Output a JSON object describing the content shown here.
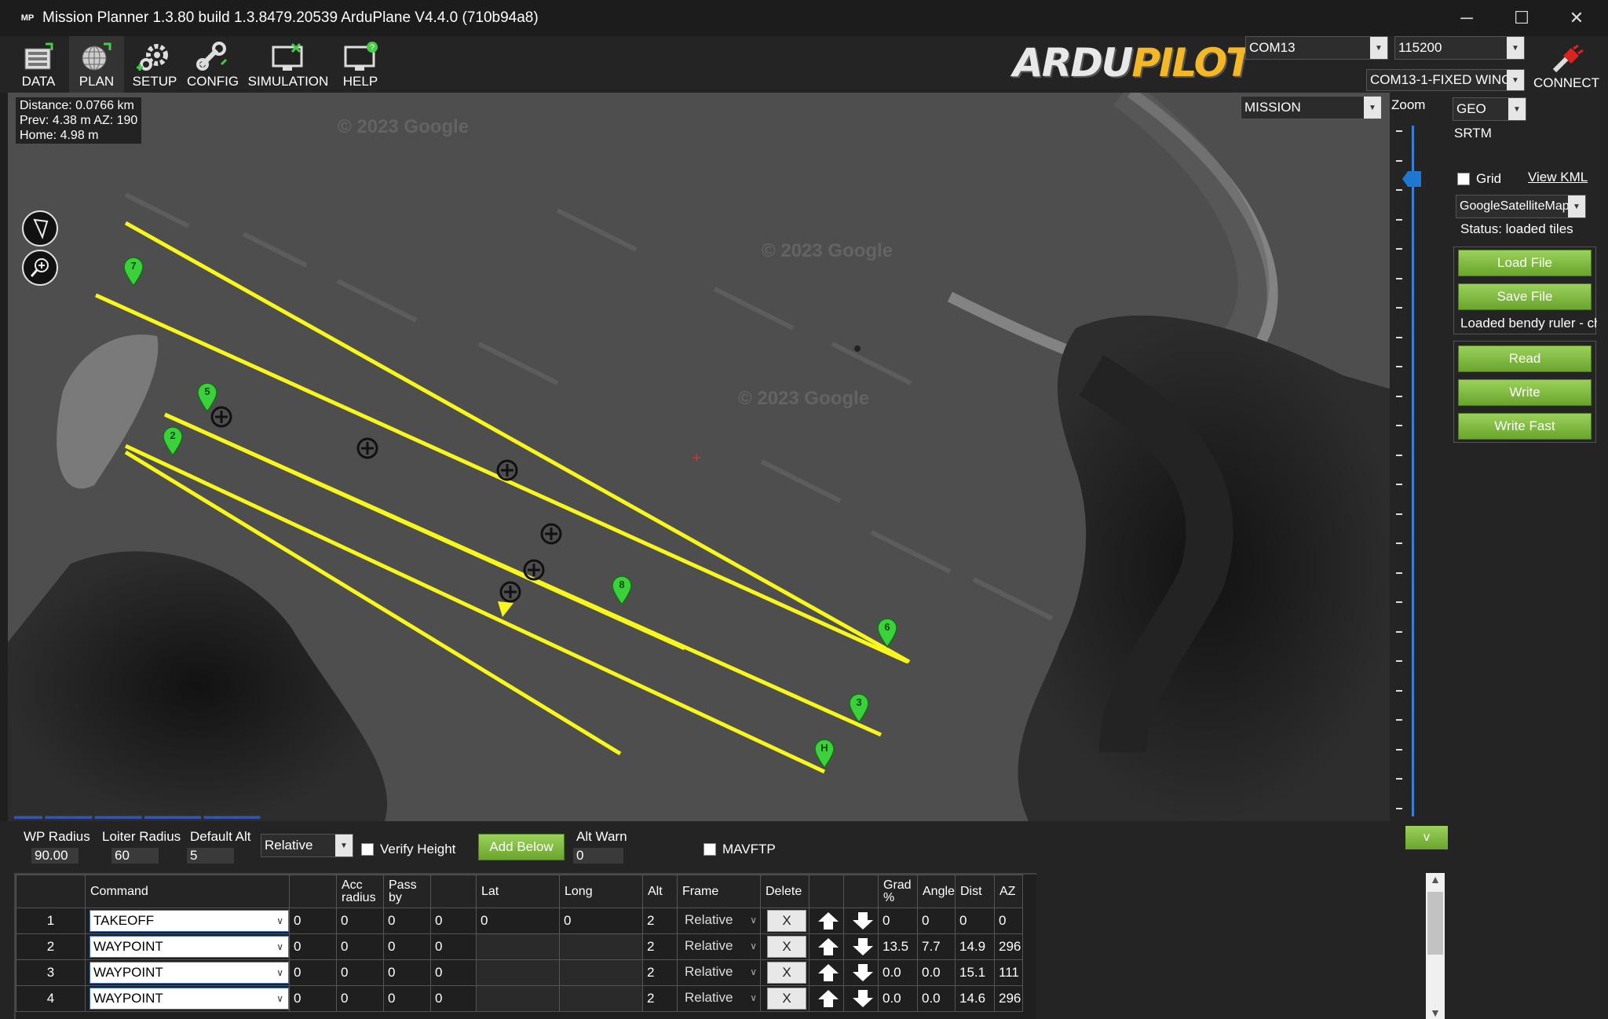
{
  "window": {
    "title": "Mission Planner 1.3.80 build 1.3.8479.20539 ArduPlane V4.4.0 (710b94a8)",
    "logo_text": "MP",
    "minimize_glyph": "─",
    "maximize_glyph": "☐",
    "close_glyph": "✕"
  },
  "toolbar": {
    "buttons": [
      {
        "label": "DATA",
        "icon": "data-icon"
      },
      {
        "label": "PLAN",
        "icon": "plan-globe-icon"
      },
      {
        "label": "SETUP",
        "icon": "setup-gear-icon"
      },
      {
        "label": "CONFIG",
        "icon": "config-wrench-icon"
      },
      {
        "label": "SIMULATION",
        "icon": "simulation-monitor-icon"
      },
      {
        "label": "HELP",
        "icon": "help-monitor-icon"
      }
    ],
    "brand_part1": "ARDU",
    "brand_part2": "PILOT",
    "port": "COM13",
    "baud": "115200",
    "vehicle": "COM13-1-FIXED WING",
    "connect_label": "CONNECT"
  },
  "map": {
    "info": {
      "distance": "Distance: 0.0766 km",
      "prev": "Prev: 4.38 m AZ: 190",
      "home": "Home: 4.98 m"
    },
    "mode": "MISSION",
    "watermark": "© 2023 Google",
    "waypoints": [
      "7",
      "5",
      "2",
      "8",
      "6",
      "3",
      "H"
    ],
    "route_color": "#f7f71e",
    "marker_color": "#3bd13b"
  },
  "right_panel": {
    "zoom_label": "Zoom",
    "geo": "GEO",
    "srtm": "SRTM",
    "grid_label": "Grid",
    "view_kml": "View KML",
    "map_type": "GoogleSatelliteMap",
    "status": "Status: loaded tiles",
    "load_file": "Load File",
    "save_file": "Save File",
    "loaded_note": "Loaded bendy ruler - ch",
    "read": "Read",
    "write": "Write",
    "write_fast": "Write Fast"
  },
  "bottom": {
    "wp_radius_label": "WP Radius",
    "wp_radius": "90.00",
    "loiter_radius_label": "Loiter Radius",
    "loiter_radius": "60",
    "default_alt_label": "Default Alt",
    "default_alt": "5",
    "alt_frame": "Relative",
    "verify_height": "Verify Height",
    "add_below": "Add Below",
    "alt_warn_label": "Alt Warn",
    "alt_warn": "0",
    "mavftp": "MAVFTP",
    "v_button": "v"
  },
  "table": {
    "headers": [
      "",
      "Command",
      "",
      "Acc radius",
      "Pass by",
      "",
      "Lat",
      "Long",
      "Alt",
      "Frame",
      "Delete",
      "",
      "",
      "Grad %",
      "Angle",
      "Dist",
      "AZ"
    ],
    "rows": [
      {
        "n": "1",
        "cmd": "TAKEOFF",
        "p1": "0",
        "p2": "0",
        "p3": "0",
        "p4": "0",
        "lat": "0",
        "lon": "0",
        "alt": "2",
        "frame": "Relative",
        "del": "X",
        "grad": "0",
        "angle": "0",
        "dist": "0",
        "az": "0"
      },
      {
        "n": "2",
        "cmd": "WAYPOINT",
        "p1": "0",
        "p2": "0",
        "p3": "0",
        "p4": "0",
        "lat": "",
        "lon": "",
        "alt": "2",
        "frame": "Relative",
        "del": "X",
        "grad": "13.5",
        "angle": "7.7",
        "dist": "14.9",
        "az": "296"
      },
      {
        "n": "3",
        "cmd": "WAYPOINT",
        "p1": "0",
        "p2": "0",
        "p3": "0",
        "p4": "0",
        "lat": "",
        "lon": "",
        "alt": "2",
        "frame": "Relative",
        "del": "X",
        "grad": "0.0",
        "angle": "0.0",
        "dist": "15.1",
        "az": "111"
      },
      {
        "n": "4",
        "cmd": "WAYPOINT",
        "p1": "0",
        "p2": "0",
        "p3": "0",
        "p4": "0",
        "lat": "",
        "lon": "",
        "alt": "2",
        "frame": "Relative",
        "del": "X",
        "grad": "0.0",
        "angle": "0.0",
        "dist": "14.6",
        "az": "296"
      }
    ]
  }
}
